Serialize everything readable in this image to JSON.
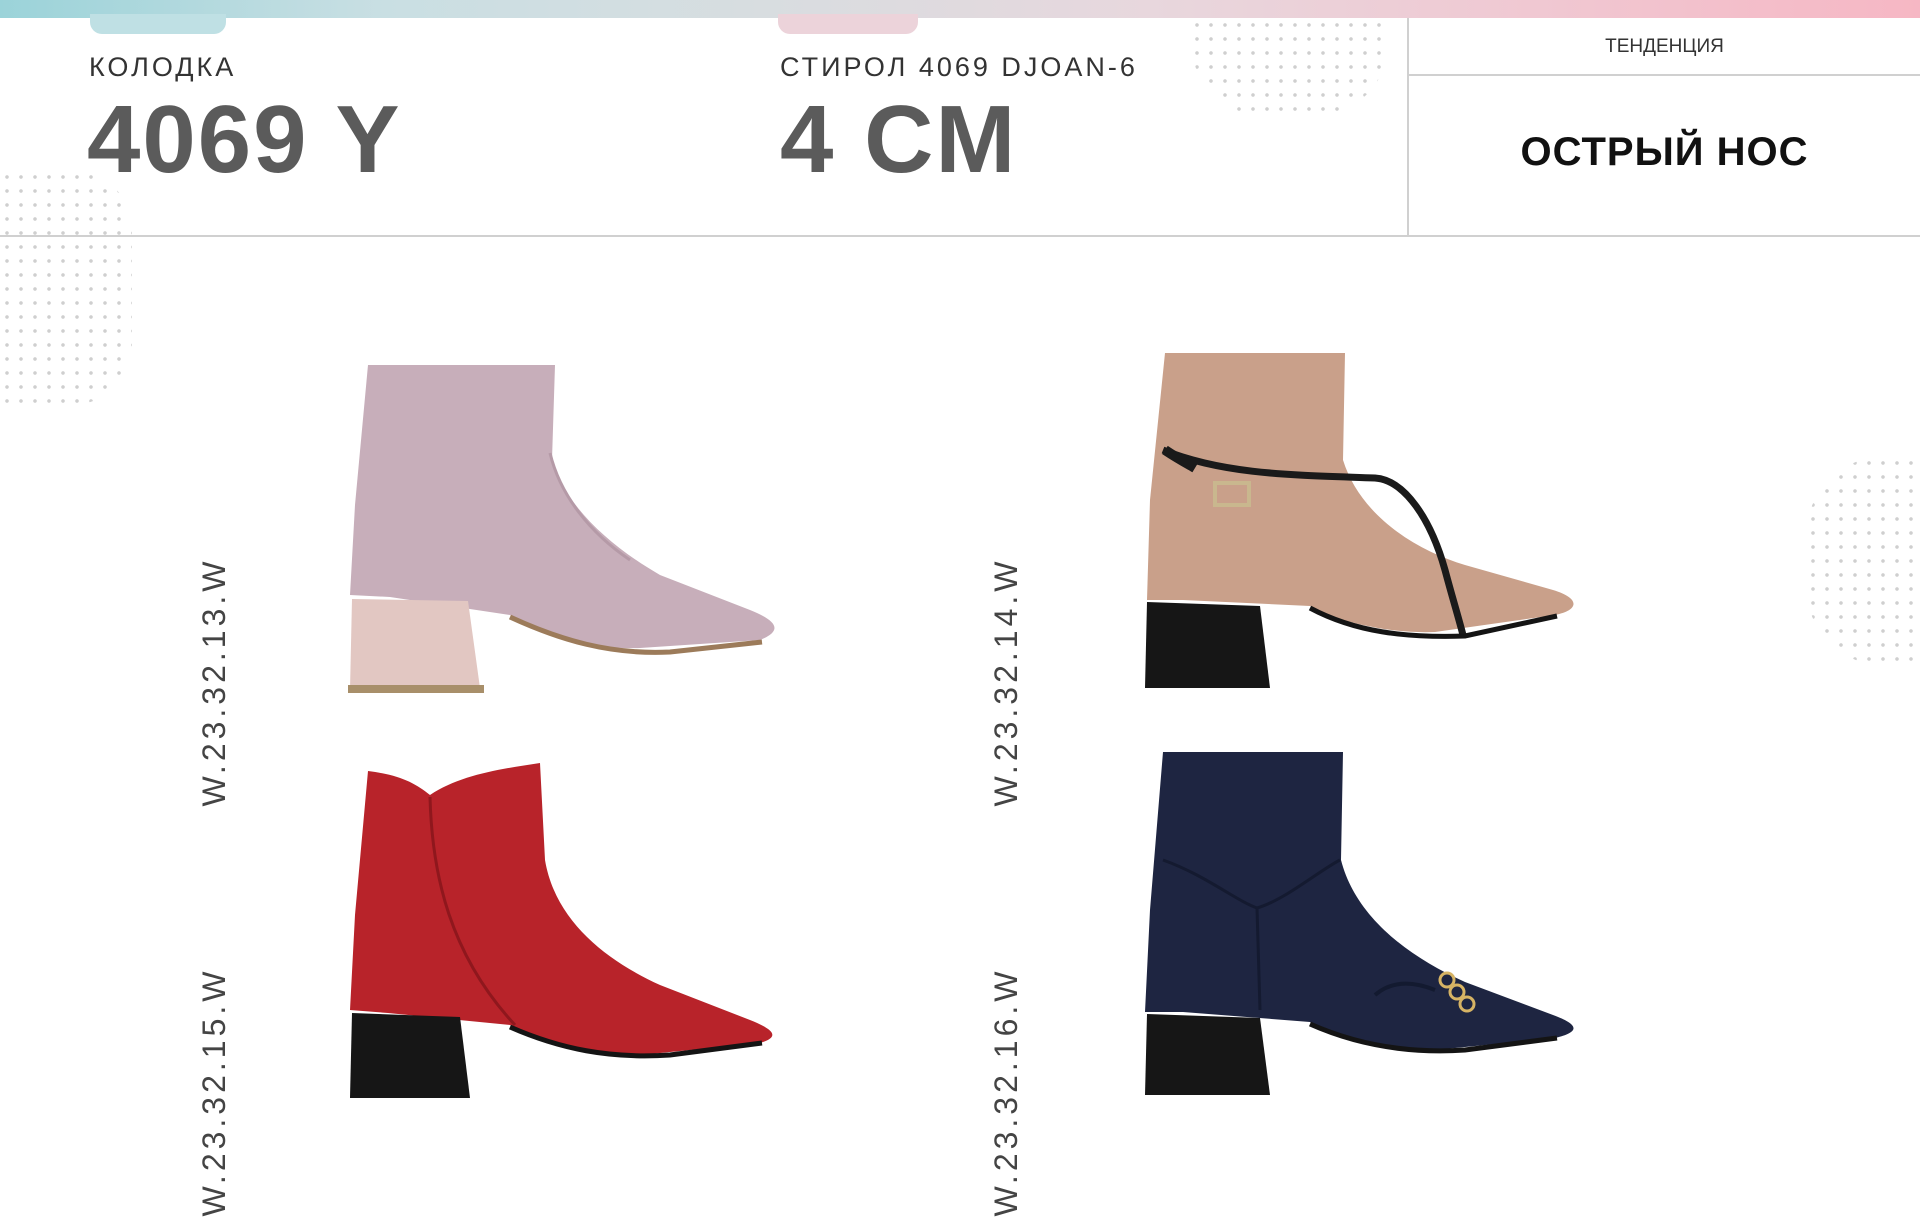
{
  "header": {
    "last_label": "КОЛОДКА",
    "last_value": "4069 Y",
    "heel_label": "СТИРОЛ 4069 DJOAN-6",
    "heel_value": "4 CM",
    "trend_title": "ТЕНДЕНЦИЯ",
    "trend_value": "ОСТРЫЙ НОС"
  },
  "products": [
    {
      "sku": "W.23.32.13.W",
      "color": "#c7aeba",
      "heel_color": "#e2c7c2"
    },
    {
      "sku": "W.23.32.14.W",
      "color": "#c9a08a",
      "heel_color": "#161616"
    },
    {
      "sku": "W.23.32.15.W",
      "color": "#b8232a",
      "heel_color": "#161616"
    },
    {
      "sku": "W.23.32.16.W",
      "color": "#1e2541",
      "heel_color": "#161616"
    }
  ],
  "colors": {
    "accent_teal": "#9bd3d9",
    "accent_pink": "#f6b7c4"
  }
}
